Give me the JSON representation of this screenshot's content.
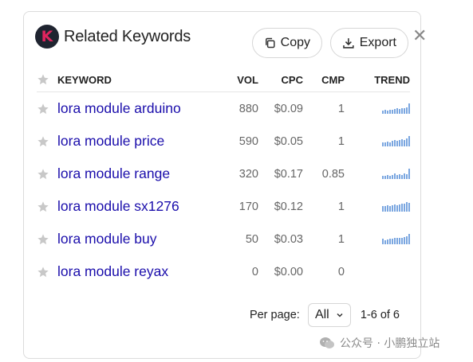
{
  "header": {
    "logo_letter": "K",
    "title": "Related Keywords",
    "copy_label": "Copy",
    "export_label": "Export",
    "close_glyph": "✕"
  },
  "table": {
    "columns": [
      "KEYWORD",
      "VOL",
      "CPC",
      "CMP",
      "TREND"
    ],
    "rows": [
      {
        "keyword": "lora module arduino",
        "vol": "880",
        "cpc": "$0.09",
        "cmp": "1",
        "trend": [
          0.3,
          0.35,
          0.3,
          0.4,
          0.35,
          0.45,
          0.5,
          0.45,
          0.5,
          0.55,
          0.6,
          1.0
        ]
      },
      {
        "keyword": "lora module price",
        "vol": "590",
        "cpc": "$0.05",
        "cmp": "1",
        "trend": [
          0.4,
          0.35,
          0.45,
          0.4,
          0.5,
          0.6,
          0.55,
          0.6,
          0.7,
          0.65,
          0.75,
          1.0
        ]
      },
      {
        "keyword": "lora module range",
        "vol": "320",
        "cpc": "$0.17",
        "cmp": "0.85",
        "trend": [
          0.3,
          0.3,
          0.35,
          0.3,
          0.35,
          0.5,
          0.4,
          0.45,
          0.4,
          0.5,
          0.45,
          1.0
        ]
      },
      {
        "keyword": "lora module sx1276",
        "vol": "170",
        "cpc": "$0.12",
        "cmp": "1",
        "trend": [
          0.55,
          0.5,
          0.6,
          0.55,
          0.6,
          0.7,
          0.65,
          0.7,
          0.8,
          0.75,
          0.9,
          0.85
        ]
      },
      {
        "keyword": "lora module buy",
        "vol": "50",
        "cpc": "$0.03",
        "cmp": "1",
        "trend": [
          0.5,
          0.4,
          0.45,
          0.5,
          0.55,
          0.6,
          0.6,
          0.65,
          0.6,
          0.7,
          0.8,
          1.0
        ]
      },
      {
        "keyword": "lora module reyax",
        "vol": "0",
        "cpc": "$0.00",
        "cmp": "0",
        "trend": []
      }
    ]
  },
  "footer": {
    "per_page_label": "Per page:",
    "per_page_value": "All",
    "range_text": "1-6 of 6"
  },
  "watermark": {
    "text": "公众号 · 小鹏独立站"
  },
  "colors": {
    "keyword_link": "#1a0dab",
    "trend_bar": "#7aa6e0",
    "logo_bg": "#1f2430",
    "logo_letter": "#e0245e"
  }
}
